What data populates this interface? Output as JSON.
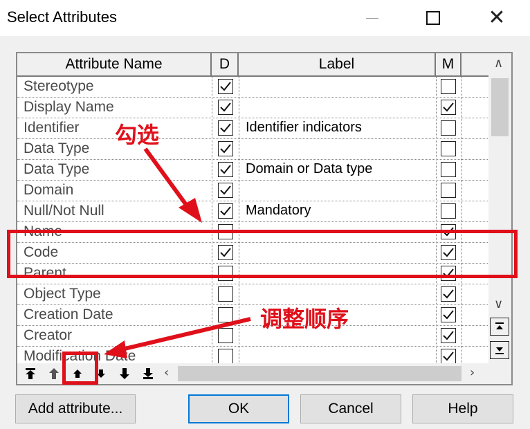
{
  "window": {
    "title": "Select Attributes",
    "controls": {
      "minimize": "—",
      "maximize": "☐",
      "close": "✕"
    }
  },
  "table": {
    "headers": {
      "name": "Attribute Name",
      "d": "D",
      "label": "Label",
      "m": "M"
    },
    "rows": [
      {
        "name": "Stereotype",
        "d": true,
        "label": "",
        "m": false
      },
      {
        "name": "Display Name",
        "d": true,
        "label": "",
        "m": true
      },
      {
        "name": "Identifier",
        "d": true,
        "label": "Identifier indicators",
        "m": false
      },
      {
        "name": "Data Type",
        "d": true,
        "label": "",
        "m": false
      },
      {
        "name": "Data Type",
        "d": true,
        "label": "Domain or Data type",
        "m": false
      },
      {
        "name": "Domain",
        "d": true,
        "label": "",
        "m": false
      },
      {
        "name": "Null/Not Null",
        "d": true,
        "label": "Mandatory",
        "m": false
      },
      {
        "name": "Name",
        "d": false,
        "label": "",
        "m": true
      },
      {
        "name": "Code",
        "d": true,
        "label": "",
        "m": true
      },
      {
        "name": "Parent",
        "d": false,
        "label": "",
        "m": true
      },
      {
        "name": "Object Type",
        "d": false,
        "label": "",
        "m": true
      },
      {
        "name": "Creation Date",
        "d": false,
        "label": "",
        "m": true
      },
      {
        "name": "Creator",
        "d": false,
        "label": "",
        "m": true
      },
      {
        "name": "Modification Date",
        "d": false,
        "label": "",
        "m": true
      }
    ]
  },
  "move_buttons": [
    {
      "name": "move-top-button",
      "icon": "arrow-to-top-icon"
    },
    {
      "name": "move-up-disabled-button",
      "icon": "arrow-up-gray-icon"
    },
    {
      "name": "move-up-button",
      "icon": "arrow-up-icon"
    },
    {
      "name": "move-down-button",
      "icon": "arrow-down-icon"
    },
    {
      "name": "move-down-more-button",
      "icon": "arrow-down-bold-icon"
    },
    {
      "name": "move-bottom-button",
      "icon": "arrow-to-bottom-icon"
    }
  ],
  "buttons": {
    "add_attribute": "Add attribute...",
    "ok": "OK",
    "cancel": "Cancel",
    "help": "Help"
  },
  "annotations": {
    "check": "勾选",
    "reorder": "调整顺序",
    "color": "#e0101a"
  }
}
